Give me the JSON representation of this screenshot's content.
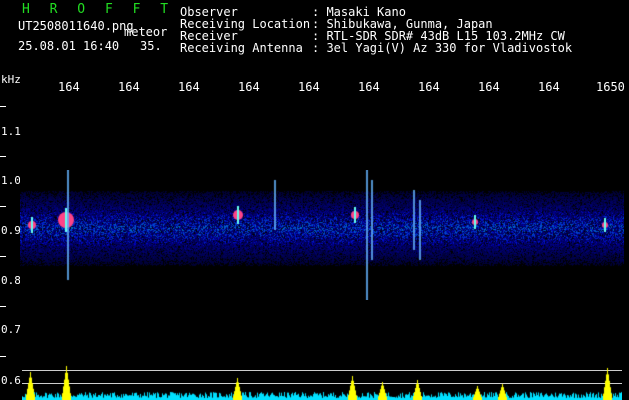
{
  "station": {
    "name": "H R O F F T",
    "filename": "UT2508011640.png",
    "type": "meteor",
    "datetime": "25.08.01 16:40",
    "count": "35."
  },
  "info": {
    "observer_label": "Observer",
    "observer_value": ": Masaki Kano",
    "location_label": "Receiving Location",
    "location_value": ": Shibukawa, Gunma, Japan",
    "receiver_label": "Receiver",
    "receiver_value": ": RTL-SDR SDR# 43dB L15 103.2MHz CW",
    "antenna_label": "Receiving Antenna",
    "antenna_value": ": 3el Yagi(V) Az 330 for Vladivostok"
  },
  "axis": {
    "unit": "kHz",
    "time_ticks": [
      "164",
      "164",
      "164",
      "164",
      "164",
      "164",
      "164",
      "164",
      "164",
      "1650"
    ],
    "freq_labels": [
      "1.1",
      "1.0",
      "0.9",
      "0.8",
      "0.7",
      "0.6"
    ]
  },
  "colors": {
    "background": "#000000",
    "title_green": "#22dd22",
    "activity_yellow": "#ffff00",
    "activity_cyan": "#00e0ff"
  }
}
